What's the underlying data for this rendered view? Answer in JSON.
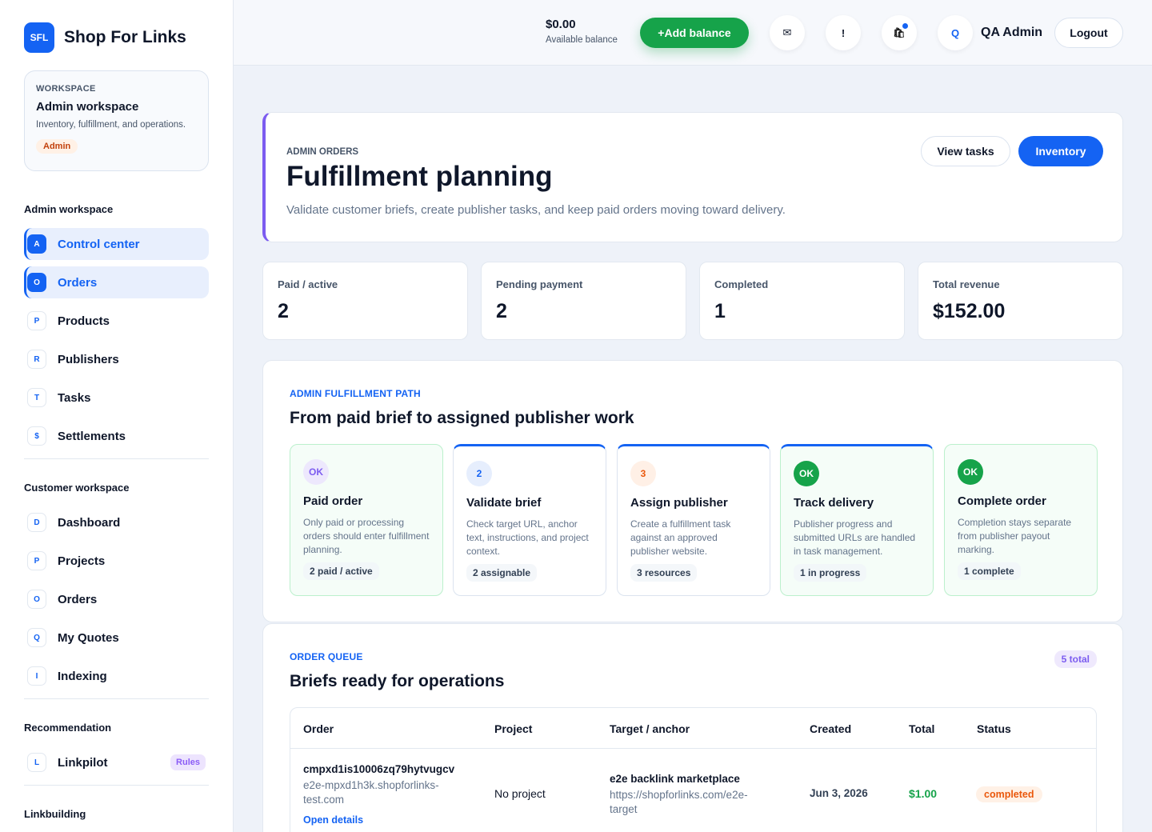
{
  "brand": {
    "logo": "SFL",
    "name": "Shop For Links"
  },
  "workspace_card": {
    "kicker": "WORKSPACE",
    "title": "Admin workspace",
    "desc": "Inventory, fulfillment, and operations.",
    "badge": "Admin"
  },
  "nav": {
    "admin_head": "Admin workspace",
    "admin_items": [
      {
        "badge": "A",
        "label": "Control center"
      },
      {
        "badge": "O",
        "label": "Orders"
      },
      {
        "badge": "P",
        "label": "Products"
      },
      {
        "badge": "R",
        "label": "Publishers"
      },
      {
        "badge": "T",
        "label": "Tasks"
      },
      {
        "badge": "$",
        "label": "Settlements"
      }
    ],
    "customer_head": "Customer workspace",
    "customer_items": [
      {
        "badge": "D",
        "label": "Dashboard"
      },
      {
        "badge": "P",
        "label": "Projects"
      },
      {
        "badge": "O",
        "label": "Orders"
      },
      {
        "badge": "Q",
        "label": "My Quotes"
      },
      {
        "badge": "I",
        "label": "Indexing"
      }
    ],
    "reco_head": "Recommendation",
    "reco_items": [
      {
        "badge": "L",
        "label": "Linkpilot",
        "tag": "Rules"
      }
    ],
    "linkbuilding_head": "Linkbuilding"
  },
  "topbar": {
    "balance_value": "$0.00",
    "balance_label": "Available balance",
    "add_balance": "+Add balance",
    "mail_glyph": "✉",
    "alert_glyph": "!",
    "cart_glyph": "🛍",
    "avatar": "Q",
    "user_name": "QA Admin",
    "logout": "Logout"
  },
  "hero": {
    "kicker": "ADMIN ORDERS",
    "title": "Fulfillment planning",
    "desc": "Validate customer briefs, create publisher tasks, and keep paid orders moving toward delivery.",
    "view_tasks": "View tasks",
    "inventory": "Inventory"
  },
  "stats": [
    {
      "label": "Paid / active",
      "value": "2"
    },
    {
      "label": "Pending payment",
      "value": "2"
    },
    {
      "label": "Completed",
      "value": "1"
    },
    {
      "label": "Total revenue",
      "value": "$152.00"
    }
  ],
  "path": {
    "kicker": "ADMIN FULFILLMENT PATH",
    "title": "From paid brief to assigned publisher work",
    "steps": [
      {
        "badge": "OK",
        "title": "Paid order",
        "desc": "Only paid or processing orders should enter fulfillment planning.",
        "chip": "2 paid / active"
      },
      {
        "badge": "2",
        "title": "Validate brief",
        "desc": "Check target URL, anchor text, instructions, and project context.",
        "chip": "2 assignable"
      },
      {
        "badge": "3",
        "title": "Assign publisher",
        "desc": "Create a fulfillment task against an approved publisher website.",
        "chip": "3 resources"
      },
      {
        "badge": "OK",
        "title": "Track delivery",
        "desc": "Publisher progress and submitted URLs are handled in task management.",
        "chip": "1 in progress"
      },
      {
        "badge": "OK",
        "title": "Complete order",
        "desc": "Completion stays separate from publisher payout marking.",
        "chip": "1 complete"
      }
    ]
  },
  "queue": {
    "kicker": "ORDER QUEUE",
    "title": "Briefs ready for operations",
    "total": "5 total",
    "columns": [
      "Order",
      "Project",
      "Target / anchor",
      "Created",
      "Total",
      "Status"
    ],
    "rows": [
      {
        "order_id": "cmpxd1is10006zq79hytvugcv",
        "order_sub": "e2e-mpxd1h3k.shopforlinks-test.com",
        "open": "Open details",
        "project": "No project",
        "anchor": "e2e backlink marketplace",
        "target": "https://shopforlinks.com/e2e-target",
        "created": "Jun 3, 2026",
        "total": "$1.00",
        "status": "completed"
      }
    ]
  },
  "colors": {
    "primary": "#1463f3",
    "success": "#16a34a",
    "accent": "#7c5cf0",
    "warning": "#ea580c"
  }
}
